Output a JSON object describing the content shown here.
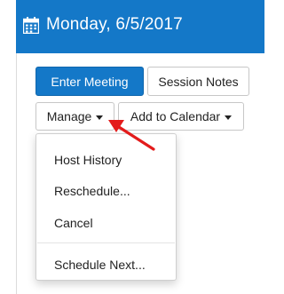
{
  "header": {
    "title": "Monday, 6/5/2017",
    "icon": "calendar-icon",
    "background": "#1478c8"
  },
  "toolbar": {
    "enter_meeting_label": "Enter Meeting",
    "session_notes_label": "Session Notes",
    "manage_label": "Manage",
    "add_to_calendar_label": "Add to Calendar"
  },
  "manage_menu": {
    "items": [
      {
        "label": "Host History"
      },
      {
        "label": "Reschedule..."
      },
      {
        "label": "Cancel"
      },
      {
        "label": "Schedule Next..."
      }
    ]
  },
  "annotation": {
    "arrow_color": "#e31b1b"
  }
}
